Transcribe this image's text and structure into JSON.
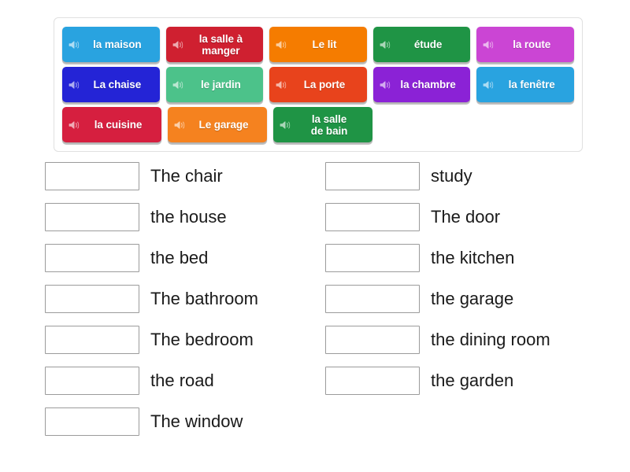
{
  "activity": {
    "type": "match-up",
    "tray": {
      "rows": [
        [
          {
            "label": "la maison",
            "color": "#29a3e0",
            "icon": "speaker-icon"
          },
          {
            "label": "la salle à\nmanger",
            "color": "#cf2030",
            "icon": "speaker-icon"
          },
          {
            "label": "Le lit",
            "color": "#f57c00",
            "icon": "speaker-icon"
          },
          {
            "label": "étude",
            "color": "#1f9445",
            "icon": "speaker-icon"
          },
          {
            "label": "la route",
            "color": "#cb45d4",
            "icon": "speaker-icon"
          }
        ],
        [
          {
            "label": "La chaise",
            "color": "#2424d6",
            "icon": "speaker-icon"
          },
          {
            "label": "le jardin",
            "color": "#4cc28a",
            "icon": "speaker-icon"
          },
          {
            "label": "La porte",
            "color": "#e8431c",
            "icon": "speaker-icon"
          },
          {
            "label": "la chambre",
            "color": "#8b22d6",
            "icon": "speaker-icon"
          },
          {
            "label": "la fenêtre",
            "color": "#29a3e0",
            "icon": "speaker-icon"
          }
        ],
        [
          {
            "label": "la cuisine",
            "color": "#d61f3f",
            "icon": "speaker-icon"
          },
          {
            "label": "Le garage",
            "color": "#f5821f",
            "icon": "speaker-icon"
          },
          {
            "label": "la salle\nde bain",
            "color": "#1f9445",
            "icon": "speaker-icon"
          }
        ]
      ]
    },
    "answers": {
      "left_column": [
        {
          "blank_value": "",
          "text": "The chair"
        },
        {
          "blank_value": "",
          "text": "the house"
        },
        {
          "blank_value": "",
          "text": "the bed"
        },
        {
          "blank_value": "",
          "text": "The bathroom"
        },
        {
          "blank_value": "",
          "text": "The bedroom"
        },
        {
          "blank_value": "",
          "text": "the road"
        },
        {
          "blank_value": "",
          "text": "The window"
        }
      ],
      "right_column": [
        {
          "blank_value": "",
          "text": "study"
        },
        {
          "blank_value": "",
          "text": "The door"
        },
        {
          "blank_value": "",
          "text": "the kitchen"
        },
        {
          "blank_value": "",
          "text": "the garage"
        },
        {
          "blank_value": "",
          "text": "the dining room"
        },
        {
          "blank_value": "",
          "text": "the garden"
        }
      ]
    }
  }
}
